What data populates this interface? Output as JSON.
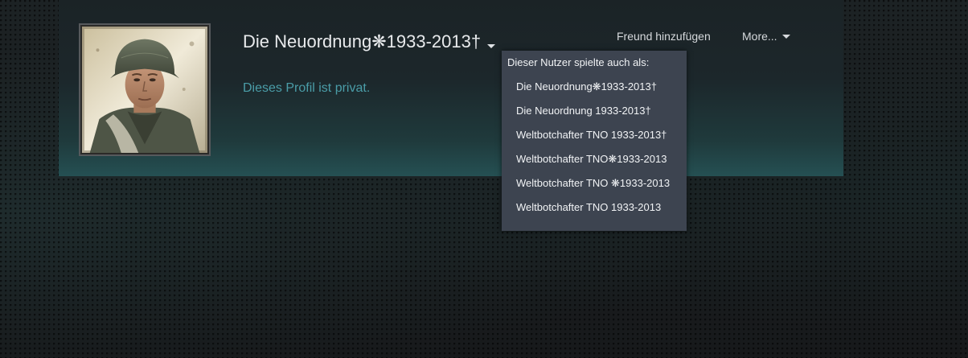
{
  "profile": {
    "persona_name": "Die Neuordnung❋1933-2013†",
    "private_message": "Dieses Profil ist privat.",
    "actions": {
      "add_friend_label": "Freund hinzufügen",
      "more_label": "More..."
    }
  },
  "name_history": {
    "header": "Dieser Nutzer spielte auch als:",
    "aliases": [
      "Die Neuordnung❋1933-2013†",
      "Die Neuordnung 1933-2013†",
      "Weltbotchafter TNO 1933-2013†",
      "Weltbotchafter TNO❋1933-2013",
      "Weltbotchafter TNO ❋1933-2013",
      "Weltbotchafter TNO 1933-2013"
    ]
  },
  "icons": {
    "name_history_toggle": "chevron-down-icon",
    "more_dropdown": "chevron-down-icon"
  },
  "colors": {
    "private_text": "#4a9da8",
    "dropdown_bg": "#3d4450",
    "header_bottom": "#255053"
  }
}
